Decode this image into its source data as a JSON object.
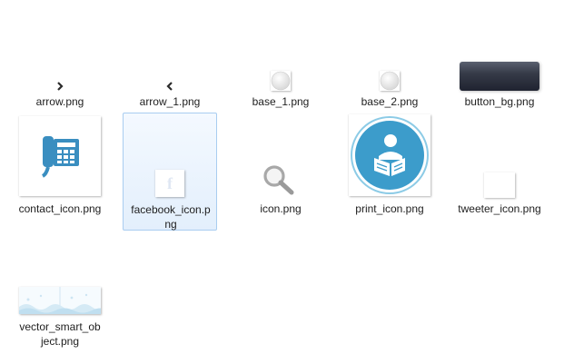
{
  "files": [
    {
      "name": "arrow.png",
      "icon": "chevron-right-icon"
    },
    {
      "name": "arrow_1.png",
      "icon": "chevron-left-icon"
    },
    {
      "name": "base_1.png",
      "icon": "circle-button-icon"
    },
    {
      "name": "base_2.png",
      "icon": "circle-button-icon"
    },
    {
      "name": "button_bg.png",
      "icon": "dark-button-background-icon"
    },
    {
      "name": "contact_icon.png",
      "icon": "telephone-icon"
    },
    {
      "name": "facebook_icon.png",
      "icon": "facebook-icon",
      "selected": true,
      "glyph": "f"
    },
    {
      "name": "icon.png",
      "icon": "magnifier-icon"
    },
    {
      "name": "print_icon.png",
      "icon": "reader-icon"
    },
    {
      "name": "tweeter_icon.png",
      "icon": "blank-thumbnail-icon"
    },
    {
      "name": "vector_smart_object.png",
      "icon": "wave-banner-icon"
    }
  ],
  "colors": {
    "selection_fill": "#e3effc",
    "selection_border": "#a9cdf0",
    "contact_blue": "#3a8ec0",
    "print_teal": "#3c9ccb"
  }
}
